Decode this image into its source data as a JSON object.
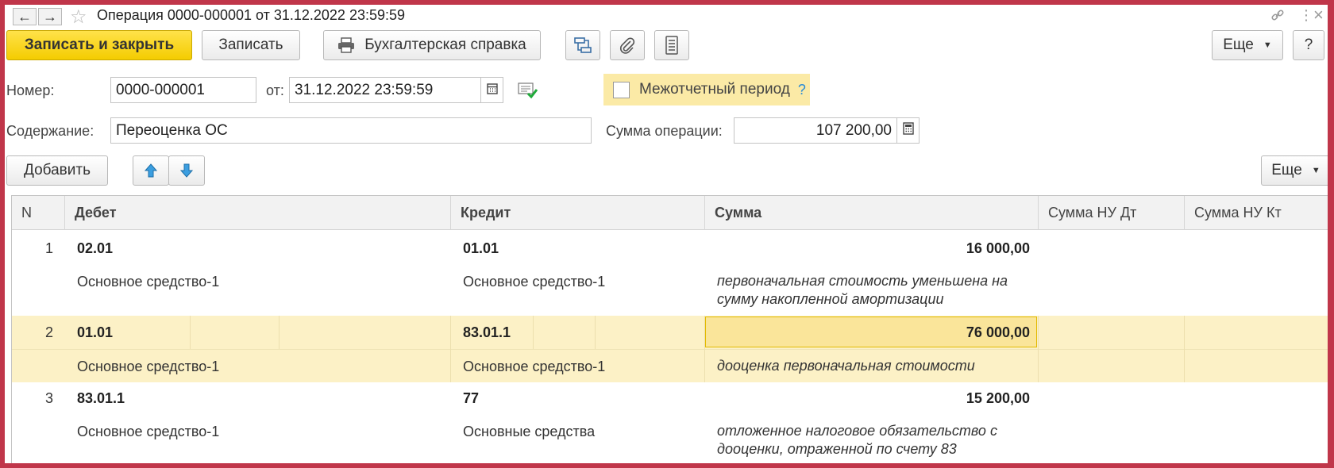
{
  "window": {
    "title": "Операция 0000-000001 от 31.12.2022 23:59:59",
    "icons": {
      "back": "←",
      "forward": "→",
      "favorite": "☆",
      "link": "link-icon",
      "menu": "⋮",
      "close": "×"
    }
  },
  "toolbar": {
    "save_close": "Записать и закрыть",
    "save": "Записать",
    "accounting_report": "Бухгалтерская справка",
    "more": "Еще",
    "help": "?"
  },
  "form": {
    "number_label": "Номер:",
    "number_value": "0000-000001",
    "date_label": "от:",
    "date_value": "31.12.2022 23:59:59",
    "period_label": "Межотчетный период",
    "period_help": "?",
    "content_label": "Содержание:",
    "content_value": "Переоценка ОС",
    "sum_label": "Сумма операции:",
    "sum_value": "107 200,00"
  },
  "table_toolbar": {
    "add": "Добавить",
    "more": "Еще"
  },
  "table": {
    "columns": {
      "n": "N",
      "debit": "Дебет",
      "credit": "Кредит",
      "sum": "Сумма",
      "sum_nu_dt": "Сумма НУ Дт",
      "sum_nu_kt": "Сумма НУ Кт"
    },
    "rows": [
      {
        "n": "1",
        "debit": "02.01",
        "debit_sub": "Основное средство-1",
        "credit": "01.01",
        "credit_sub": "Основное средство-1",
        "sum": "16 000,00",
        "comment": "первоначальная стоимость уменьшена на сумму накопленной амортизации"
      },
      {
        "n": "2",
        "debit": "01.01",
        "debit_sub": "Основное средство-1",
        "credit": "83.01.1",
        "credit_sub": "Основное средство-1",
        "sum": "76 000,00",
        "comment": "дооценка первоначальная стоимости"
      },
      {
        "n": "3",
        "debit": "83.01.1",
        "debit_sub": "Основное средство-1",
        "credit": "77",
        "credit_sub": "Основные средства",
        "sum": "15 200,00",
        "comment": "отложенное налоговое обязательство с дооценки, отраженной по счету 83"
      }
    ]
  }
}
